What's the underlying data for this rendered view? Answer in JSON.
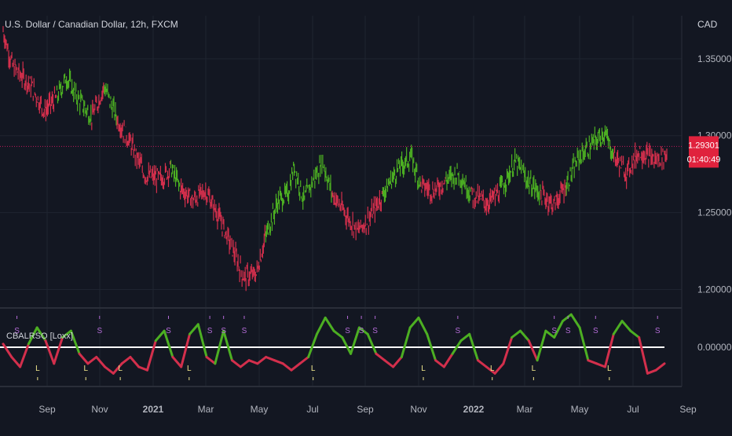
{
  "header": {
    "symbol_title": "U.S. Dollar / Canadian Dollar, 12h, FXCM",
    "currency_label": "CAD"
  },
  "colors": {
    "background": "#131722",
    "grid": "#1f2430",
    "up": "#4caf22",
    "down": "#d32f4c",
    "zero_line": "#ffffff",
    "price_label_bg": "#e0223d",
    "current_price_line": "#c2185b",
    "signal_s": "#b36bd6",
    "signal_l": "#f0e68c",
    "text": "#b2b5be"
  },
  "chart_data": [
    {
      "type": "candlestick",
      "title": "U.S. Dollar / Canadian Dollar, 12h, FXCM",
      "x_ticks": [
        "Sep",
        "Nov",
        "2021",
        "Mar",
        "May",
        "Jul",
        "Sep",
        "Nov",
        "2022",
        "Mar",
        "May",
        "Jul",
        "Sep"
      ],
      "bold_x_ticks": [
        "2021",
        "2022"
      ],
      "y_ticks": [
        "1.35000",
        "1.30000",
        "1.25000",
        "1.20000"
      ],
      "ylim": [
        1.188,
        1.378
      ],
      "grid": true,
      "current_price": "1.29301",
      "countdown": "01:40:49",
      "price_path": [
        {
          "x": 0,
          "y": 1.368,
          "trend": "down"
        },
        {
          "x": 0.3,
          "y": 1.345,
          "trend": "down"
        },
        {
          "x": 0.9,
          "y": 1.332,
          "trend": "down"
        },
        {
          "x": 1.3,
          "y": 1.316,
          "trend": "down"
        },
        {
          "x": 1.7,
          "y": 1.325,
          "trend": "up"
        },
        {
          "x": 2.0,
          "y": 1.338,
          "trend": "up"
        },
        {
          "x": 2.3,
          "y": 1.326,
          "trend": "up"
        },
        {
          "x": 2.8,
          "y": 1.312,
          "trend": "down"
        },
        {
          "x": 3.2,
          "y": 1.332,
          "trend": "up"
        },
        {
          "x": 3.6,
          "y": 1.311,
          "trend": "down"
        },
        {
          "x": 4.0,
          "y": 1.296,
          "trend": "down"
        },
        {
          "x": 4.5,
          "y": 1.274,
          "trend": "down"
        },
        {
          "x": 5.0,
          "y": 1.272,
          "trend": "down"
        },
        {
          "x": 5.3,
          "y": 1.279,
          "trend": "up"
        },
        {
          "x": 5.6,
          "y": 1.266,
          "trend": "down"
        },
        {
          "x": 6.0,
          "y": 1.258,
          "trend": "down"
        },
        {
          "x": 6.4,
          "y": 1.264,
          "trend": "down"
        },
        {
          "x": 6.8,
          "y": 1.248,
          "trend": "down"
        },
        {
          "x": 7.2,
          "y": 1.229,
          "trend": "down"
        },
        {
          "x": 7.6,
          "y": 1.208,
          "trend": "down"
        },
        {
          "x": 8.0,
          "y": 1.21,
          "trend": "down"
        },
        {
          "x": 8.3,
          "y": 1.235,
          "trend": "up"
        },
        {
          "x": 8.7,
          "y": 1.258,
          "trend": "up"
        },
        {
          "x": 9.0,
          "y": 1.262,
          "trend": "up"
        },
        {
          "x": 9.2,
          "y": 1.28,
          "trend": "up"
        },
        {
          "x": 9.5,
          "y": 1.258,
          "trend": "up"
        },
        {
          "x": 9.8,
          "y": 1.271,
          "trend": "up"
        },
        {
          "x": 10.1,
          "y": 1.283,
          "trend": "up"
        },
        {
          "x": 10.4,
          "y": 1.262,
          "trend": "down"
        },
        {
          "x": 10.8,
          "y": 1.25,
          "trend": "down"
        },
        {
          "x": 11.2,
          "y": 1.238,
          "trend": "down"
        },
        {
          "x": 11.6,
          "y": 1.247,
          "trend": "down"
        },
        {
          "x": 12.0,
          "y": 1.262,
          "trend": "up"
        },
        {
          "x": 12.5,
          "y": 1.279,
          "trend": "up"
        },
        {
          "x": 12.9,
          "y": 1.286,
          "trend": "up"
        },
        {
          "x": 13.2,
          "y": 1.268,
          "trend": "down"
        },
        {
          "x": 13.6,
          "y": 1.264,
          "trend": "down"
        },
        {
          "x": 14.0,
          "y": 1.271,
          "trend": "up"
        },
        {
          "x": 14.4,
          "y": 1.276,
          "trend": "up"
        },
        {
          "x": 14.8,
          "y": 1.262,
          "trend": "down"
        },
        {
          "x": 15.3,
          "y": 1.256,
          "trend": "down"
        },
        {
          "x": 15.7,
          "y": 1.264,
          "trend": "up"
        },
        {
          "x": 16.2,
          "y": 1.283,
          "trend": "up"
        },
        {
          "x": 16.6,
          "y": 1.27,
          "trend": "up"
        },
        {
          "x": 17.0,
          "y": 1.262,
          "trend": "down"
        },
        {
          "x": 17.4,
          "y": 1.255,
          "trend": "down"
        },
        {
          "x": 17.8,
          "y": 1.268,
          "trend": "up"
        },
        {
          "x": 18.2,
          "y": 1.286,
          "trend": "up"
        },
        {
          "x": 18.6,
          "y": 1.294,
          "trend": "up"
        },
        {
          "x": 19.0,
          "y": 1.302,
          "trend": "up"
        },
        {
          "x": 19.3,
          "y": 1.287,
          "trend": "down"
        },
        {
          "x": 19.7,
          "y": 1.276,
          "trend": "down"
        },
        {
          "x": 20.1,
          "y": 1.29,
          "trend": "down"
        },
        {
          "x": 20.6,
          "y": 1.284,
          "trend": "down"
        },
        {
          "x": 21.0,
          "y": 1.288,
          "trend": "down"
        }
      ]
    },
    {
      "type": "line",
      "title": "CBALRSO [Loxx]",
      "y_ticks": [
        "0.00000"
      ],
      "zero_line": 0,
      "ylim": [
        -1.2,
        1.2
      ],
      "values": [
        0.1,
        -0.3,
        -0.6,
        0.1,
        0.6,
        0.2,
        -0.5,
        0.3,
        0.5,
        -0.2,
        -0.5,
        -0.3,
        -0.6,
        -0.8,
        -0.5,
        -0.3,
        -0.6,
        -0.7,
        0.2,
        0.5,
        -0.3,
        -0.6,
        0.4,
        0.7,
        -0.3,
        -0.5,
        0.5,
        -0.4,
        -0.6,
        -0.4,
        -0.5,
        -0.3,
        -0.4,
        -0.5,
        -0.7,
        -0.5,
        -0.3,
        0.4,
        0.9,
        0.5,
        0.3,
        -0.2,
        0.6,
        0.4,
        -0.2,
        -0.4,
        -0.6,
        -0.3,
        0.6,
        0.9,
        0.4,
        -0.4,
        -0.6,
        -0.2,
        0.2,
        0.4,
        -0.4,
        -0.6,
        -0.8,
        -0.5,
        0.3,
        0.5,
        0.2,
        -0.4,
        0.5,
        0.3,
        0.8,
        1.0,
        0.6,
        -0.4,
        -0.5,
        -0.6,
        0.4,
        0.8,
        0.5,
        0.3,
        -0.8,
        -0.7,
        -0.5
      ],
      "signals": [
        {
          "label": "S",
          "index": 2
        },
        {
          "label": "L",
          "index": 5
        },
        {
          "label": "L",
          "index": 12
        },
        {
          "label": "S",
          "index": 14
        },
        {
          "label": "L",
          "index": 17
        },
        {
          "label": "S",
          "index": 24
        },
        {
          "label": "L",
          "index": 27
        },
        {
          "label": "S",
          "index": 30
        },
        {
          "label": "S",
          "index": 32
        },
        {
          "label": "S",
          "index": 35
        },
        {
          "label": "L",
          "index": 45
        },
        {
          "label": "S",
          "index": 50
        },
        {
          "label": "S",
          "index": 52
        },
        {
          "label": "S",
          "index": 54
        },
        {
          "label": "L",
          "index": 61
        },
        {
          "label": "S",
          "index": 66
        },
        {
          "label": "L",
          "index": 71
        },
        {
          "label": "L",
          "index": 77
        },
        {
          "label": "S",
          "index": 80
        },
        {
          "label": "S",
          "index": 82
        },
        {
          "label": "S",
          "index": 86
        },
        {
          "label": "L",
          "index": 88
        },
        {
          "label": "S",
          "index": 95
        }
      ]
    }
  ]
}
